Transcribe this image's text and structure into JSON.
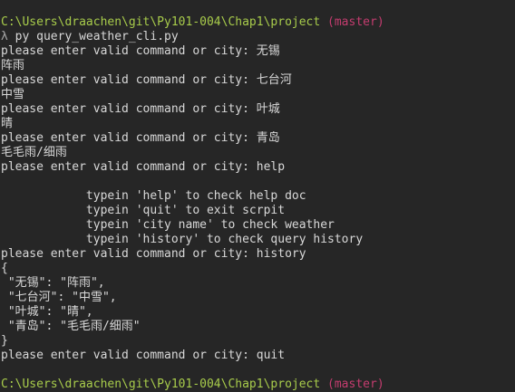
{
  "prompt": {
    "path": "C:\\Users\\draachen\\git\\Py101-004\\Chap1\\project",
    "branch": "(master)",
    "lambda": "λ",
    "command": "py query_weather_cli.py"
  },
  "output_lines": [
    "please enter valid command or city: 无锡",
    "阵雨",
    "please enter valid command or city: 七台河",
    "中雪",
    "please enter valid command or city: 叶城",
    "晴",
    "please enter valid command or city: 青岛",
    "毛毛雨/细雨",
    "please enter valid command or city: help",
    "",
    "            typein 'help' to check help doc",
    "            typein 'quit' to exit scrpit",
    "            typein 'city name' to check weather",
    "            typein 'history' to check query history",
    "please enter valid command or city: history",
    "{",
    " \"无锡\": \"阵雨\",",
    " \"七台河\": \"中雪\",",
    " \"叶城\": \"晴\",",
    " \"青岛\": \"毛毛雨/细雨\"",
    "}",
    "please enter valid command or city: quit",
    ""
  ],
  "final_prompt": {
    "path": "C:\\Users\\draachen\\git\\Py101-004\\Chap1\\project",
    "branch": "(master)"
  },
  "colors": {
    "background": "#262626",
    "text": "#d8d8d8",
    "path": "#a8cc4b",
    "branch": "#c43c6f"
  }
}
